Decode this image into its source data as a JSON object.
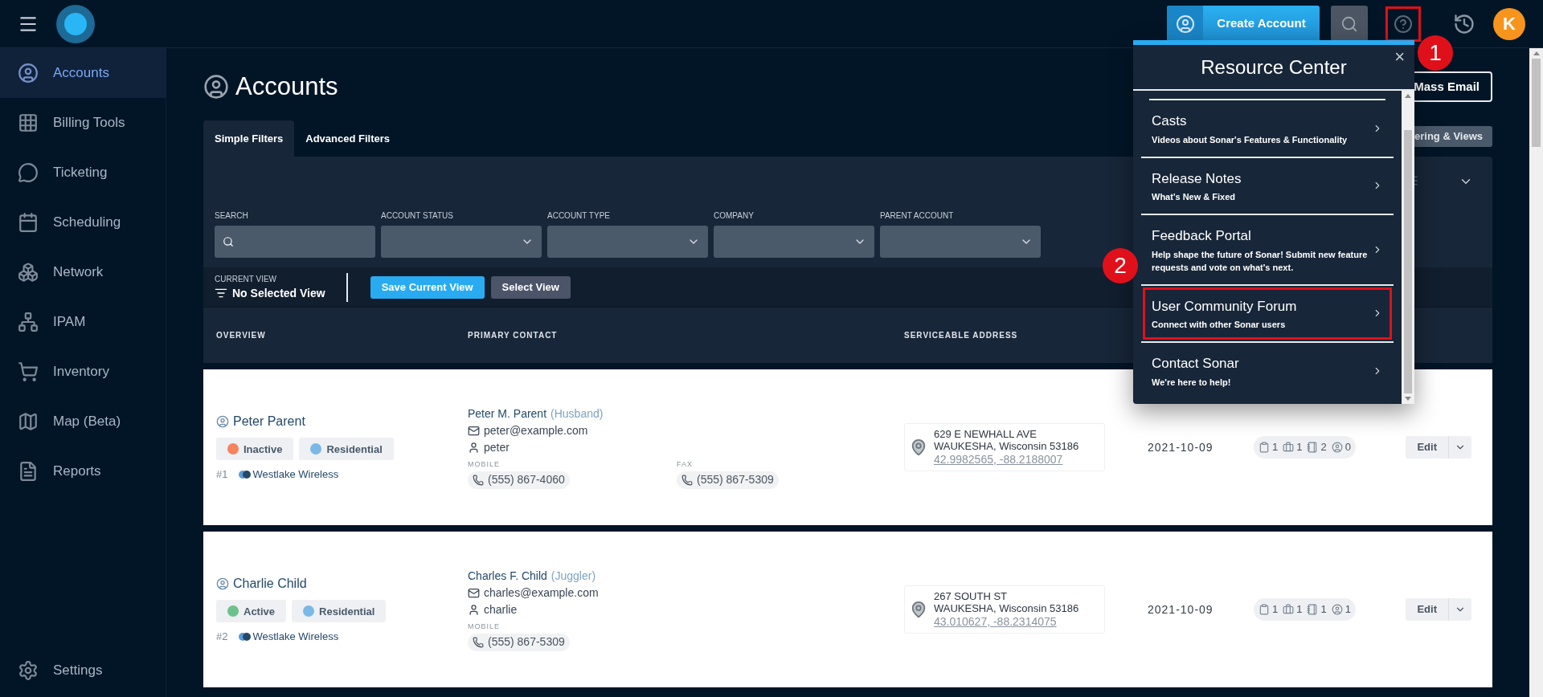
{
  "topbar": {
    "create_button": "Create Account",
    "help_annotated": true,
    "avatar": "K"
  },
  "sidebar": {
    "items": [
      {
        "label": "Accounts",
        "selected": true
      },
      {
        "label": "Billing Tools",
        "selected": false
      },
      {
        "label": "Ticketing",
        "selected": false
      },
      {
        "label": "Scheduling",
        "selected": false
      },
      {
        "label": "Network",
        "selected": false
      },
      {
        "label": "IPAM",
        "selected": false
      },
      {
        "label": "Inventory",
        "selected": false
      },
      {
        "label": "Map (Beta)",
        "selected": false
      },
      {
        "label": "Reports",
        "selected": false
      }
    ],
    "settings": "Settings"
  },
  "page": {
    "title": "Accounts",
    "mass_email": "Mass Email",
    "views_button": "ering & Views"
  },
  "tabs": [
    {
      "label": "Simple Filters",
      "selected": true
    },
    {
      "label": "Advanced Filters",
      "selected": false
    }
  ],
  "filters": [
    {
      "label": "SEARCH",
      "kind": "search"
    },
    {
      "label": "ACCOUNT STATUS",
      "kind": "select"
    },
    {
      "label": "ACCOUNT TYPE",
      "kind": "select"
    },
    {
      "label": "COMPANY",
      "kind": "select"
    },
    {
      "label": "PARENT ACCOUNT",
      "kind": "select"
    }
  ],
  "current_view": {
    "label": "CURRENT VIEW",
    "value": "No Selected View",
    "save_button": "Save Current View",
    "select_button": "Select View"
  },
  "table": {
    "columns": [
      "OVERVIEW",
      "PRIMARY CONTACT",
      "SERVICEABLE ADDRESS"
    ],
    "rows": [
      {
        "name": "Peter Parent",
        "status": {
          "label": "Inactive",
          "color": "#f4845f"
        },
        "type": {
          "label": "Residential",
          "color": "#7ab8e6"
        },
        "number": "#1",
        "company": "Westlake Wireless",
        "contact": "Peter M. Parent",
        "relation": "(Husband)",
        "email": "peter@example.com",
        "username": "peter",
        "phones": [
          {
            "label": "MOBILE",
            "number": "(555) 867-4060"
          },
          {
            "label": "FAX",
            "number": "(555) 867-5309"
          }
        ],
        "address": [
          "629 E NEWHALL AVE",
          "WAUKESHA, Wisconsin 53186"
        ],
        "coords": "42.9982565, -88.2188007",
        "date": "2021-10-09",
        "counts": [
          "1",
          "1",
          "2",
          "0"
        ],
        "edit": "Edit"
      },
      {
        "name": "Charlie Child",
        "status": {
          "label": "Active",
          "color": "#6cc28a"
        },
        "type": {
          "label": "Residential",
          "color": "#7ab8e6"
        },
        "number": "#2",
        "company": "Westlake Wireless",
        "contact": "Charles F. Child",
        "relation": "(Juggler)",
        "email": "charles@example.com",
        "username": "charlie",
        "phones": [
          {
            "label": "MOBILE",
            "number": "(555) 867-5309"
          }
        ],
        "address": [
          "267 SOUTH ST",
          "WAUKESHA, Wisconsin 53186"
        ],
        "coords": "43.010627, -88.2314075",
        "date": "2021-10-09",
        "counts": [
          "1",
          "1",
          "1",
          "1"
        ],
        "edit": "Edit"
      }
    ]
  },
  "resource_center": {
    "title": "Resource Center",
    "close": "×",
    "items": [
      {
        "title": "Casts",
        "subtitle": "Videos about Sonar's Features & Functionality",
        "highlighted": false
      },
      {
        "title": "Release Notes",
        "subtitle": "What's New & Fixed",
        "highlighted": false
      },
      {
        "title": "Feedback Portal",
        "subtitle": "Help shape the future of Sonar! Submit new feature requests and vote on what's next.",
        "highlighted": false
      },
      {
        "title": "User Community Forum",
        "subtitle": "Connect with other Sonar users",
        "highlighted": true
      },
      {
        "title": "Contact Sonar",
        "subtitle": "We're here to help!",
        "highlighted": false
      }
    ]
  },
  "annotations": [
    {
      "label": "1"
    },
    {
      "label": "2"
    }
  ]
}
